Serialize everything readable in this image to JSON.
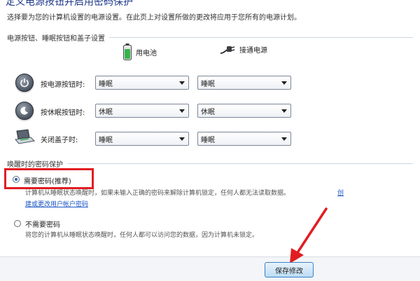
{
  "header": {
    "title": "定义电源按钮并启用密码保护",
    "subtitle": "选择要为您的计算机设置的电源设置。在此页上对设置所做的更改将应用于您所有的电源计划。"
  },
  "power_section": {
    "title": "电源按钮、睡眠按钮和盖子设置",
    "columns": {
      "battery": "用电池",
      "plugged": "接通电源"
    },
    "rows": [
      {
        "label": "按电源按钮时:",
        "battery": "睡眠",
        "plugged": "睡眠"
      },
      {
        "label": "按休眠按钮时:",
        "battery": "休眠",
        "plugged": "休眠"
      },
      {
        "label": "关闭盖子时:",
        "battery": "睡眠",
        "plugged": "睡眠"
      }
    ]
  },
  "wake_section": {
    "title": "唤醒时的密码保护",
    "require": {
      "label": "需要密码(推荐)",
      "desc": "计算机从睡眠状态唤醒时，如果未输入正确的密码来解除计算机锁定，任何人都无法读取数据。",
      "link_a": "创",
      "link_b": "建或更改用户帐户密码"
    },
    "norequire": {
      "label": "不需要密码",
      "desc": "将您的计算机从睡眠状态唤醒时，任何人都可以访问您的数据，因为计算机未锁定。"
    }
  },
  "footer": {
    "save_label": "保存修改"
  },
  "colors": {
    "accent_red": "#e11d22",
    "link_blue": "#1a56c4",
    "title_blue": "#1e3a8a"
  }
}
